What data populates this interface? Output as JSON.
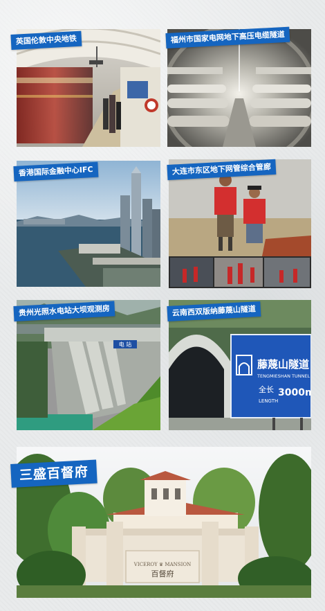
{
  "photos": [
    {
      "caption": "英国伦敦中央地铁"
    },
    {
      "caption": "福州市国家电网地下高压电缆隧道"
    },
    {
      "caption": "香港国际金融中心IFC"
    },
    {
      "caption": "大连市东区地下网管综合管廊"
    },
    {
      "caption": "贵州光照水电站大坝观测房"
    },
    {
      "caption": "云南西双版纳藤蔑山隧道"
    }
  ],
  "hero": {
    "caption": "三盛百督府",
    "gate_text_en": "VICEROY ♛ MANSION",
    "gate_text_cn": "百督府"
  },
  "tunnel_sign": {
    "cn": "藤蔑山隧道",
    "pinyin": "TENGMIESHAN TUNNEL",
    "length_cn": "全长",
    "length_en": "LENGTH",
    "length_value": "3000m"
  },
  "dam_sign": {
    "text": "电 站"
  },
  "colors": {
    "caption_blue": "#1565c0",
    "page_bg": "#e9ebec"
  }
}
